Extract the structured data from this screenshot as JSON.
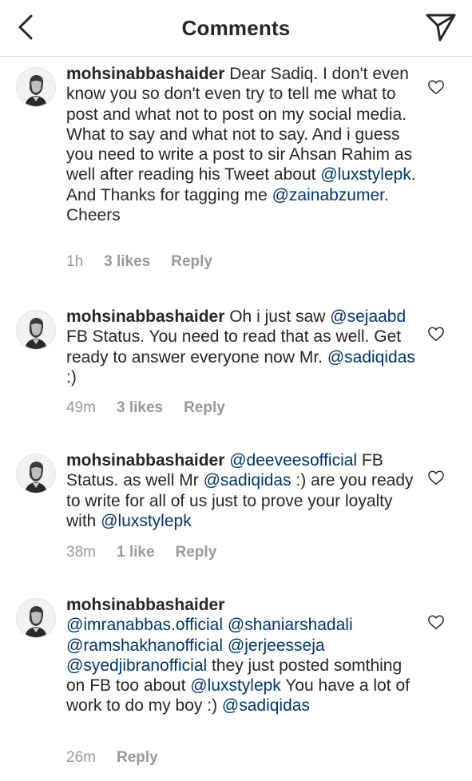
{
  "header": {
    "title": "Comments",
    "back_icon": "chevron-left-icon",
    "send_icon": "paper-plane-icon"
  },
  "colors": {
    "text": "#262626",
    "mention": "#003569",
    "meta": "#999999",
    "divider": "#dbdbdb"
  },
  "comments": [
    {
      "username": "mohsinabbashaider",
      "segments": [
        {
          "t": " Dear Sadiq. I don't even know you so don't even try to tell me what to post and what not to post on my social media. What to say and what not to say. And i guess you need to write a post to sir Ahsan Rahim as well after reading his Tweet about "
        },
        {
          "m": "@luxstylepk"
        },
        {
          "t": ". And Thanks for tagging me "
        },
        {
          "m": "@zainabzumer"
        },
        {
          "t": ". Cheers"
        }
      ],
      "time": "1h",
      "likes": "3 likes",
      "reply": "Reply"
    },
    {
      "username": "mohsinabbashaider",
      "segments": [
        {
          "t": " Oh i just saw "
        },
        {
          "m": "@sejaabd"
        },
        {
          "t": " FB Status. You need to read that as well. Get ready to answer everyone now Mr. "
        },
        {
          "m": "@sadiqidas"
        },
        {
          "t": " :)"
        }
      ],
      "time": "49m",
      "likes": "3 likes",
      "reply": "Reply"
    },
    {
      "username": "mohsinabbashaider",
      "segments": [
        {
          "t": " "
        },
        {
          "m": "@deeveesofficial"
        },
        {
          "t": " FB Status. as well Mr "
        },
        {
          "m": "@sadiqidas"
        },
        {
          "t": " :) are you ready to write for all of us just to prove your loyalty with "
        },
        {
          "m": "@luxstylepk"
        }
      ],
      "time": "38m",
      "likes": "1 like",
      "reply": "Reply"
    },
    {
      "username": "mohsinabbashaider",
      "segments": [
        {
          "t": " "
        },
        {
          "m": "@imranabbas.official"
        },
        {
          "t": "  "
        },
        {
          "m": "@shaniarshadali"
        },
        {
          "t": " "
        },
        {
          "m": "@ramshakhanofficial"
        },
        {
          "t": "  "
        },
        {
          "m": "@jerjeesseja"
        },
        {
          "t": " "
        },
        {
          "m": "@syedjibranofficial"
        },
        {
          "t": " they just posted somthing on FB too about "
        },
        {
          "m": "@luxstylepk"
        },
        {
          "t": " You have a lot of work to do my boy :) "
        },
        {
          "m": "@sadiqidas"
        }
      ],
      "time": "26m",
      "likes": "",
      "reply": "Reply"
    }
  ]
}
